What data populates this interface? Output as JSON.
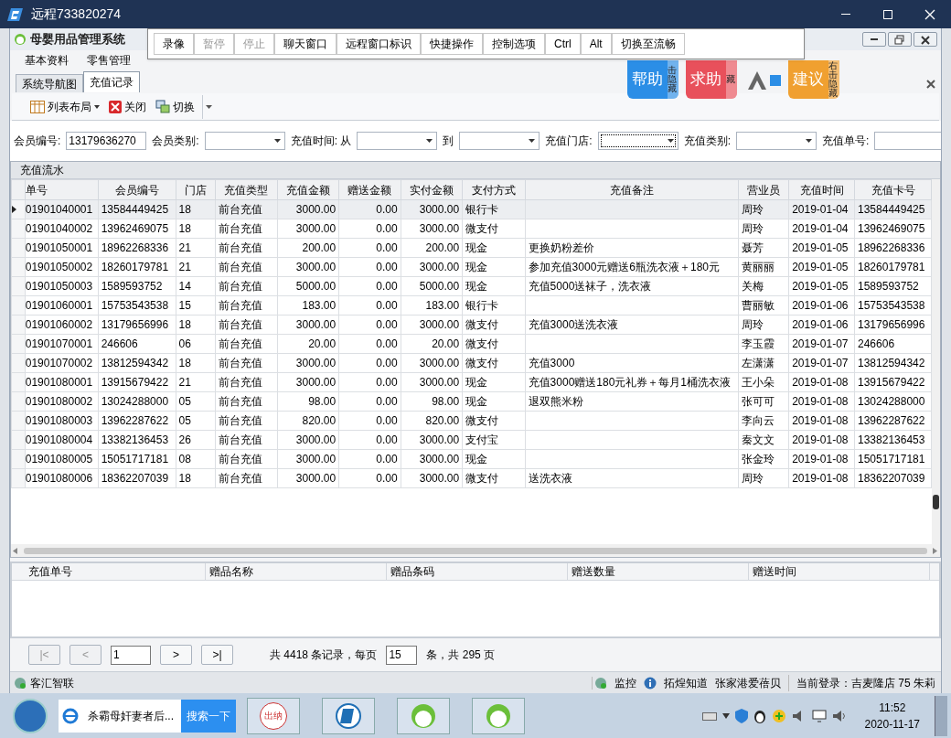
{
  "window": {
    "title": "远程733820274"
  },
  "remote_toolbar": [
    {
      "label": "录像",
      "disabled": false
    },
    {
      "label": "暂停",
      "disabled": true
    },
    {
      "label": "停止",
      "disabled": true
    },
    {
      "label": "聊天窗口",
      "disabled": false
    },
    {
      "label": "远程窗口标识",
      "disabled": false
    },
    {
      "label": "快捷操作",
      "disabled": false
    },
    {
      "label": "控制选项",
      "disabled": false
    },
    {
      "label": "Ctrl",
      "disabled": false
    },
    {
      "label": "Alt",
      "disabled": false
    },
    {
      "label": "切换至流畅",
      "disabled": false
    }
  ],
  "app": {
    "title": "母婴用品管理系统"
  },
  "menu": [
    "基本资料",
    "零售管理"
  ],
  "promo_badges": [
    {
      "main": "帮助",
      "side": "击隐藏",
      "color": "#2b8ee6"
    },
    {
      "main": "求助",
      "side": "藏",
      "color": "#e8505b"
    },
    {
      "main": "建议",
      "side": "右击隐藏",
      "color": "#f0a030"
    }
  ],
  "tabs": [
    {
      "label": "系统导航图",
      "selected": false
    },
    {
      "label": "充值记录",
      "selected": true
    }
  ],
  "toolbar": [
    {
      "label": "列表布局",
      "kind": "dropdown"
    },
    {
      "label": "关闭",
      "kind": "close"
    },
    {
      "label": "切换",
      "kind": "switch"
    }
  ],
  "filters": [
    {
      "label": "会员编号:",
      "value": "13179636270",
      "kind": "text"
    },
    {
      "label": "会员类别:",
      "kind": "combo"
    },
    {
      "label": "充值时间: 从",
      "kind": "combo"
    },
    {
      "label": "到",
      "kind": "combo"
    },
    {
      "label": "充值门店:",
      "kind": "combo",
      "focused": true
    },
    {
      "label": "充值类别:",
      "kind": "combo"
    },
    {
      "label": "充值单号:",
      "kind": "text"
    }
  ],
  "grid": {
    "group_title": "充值流水",
    "columns": [
      "单号",
      "会员编号",
      "门店",
      "充值类型",
      "充值金额",
      "赠送金额",
      "实付金额",
      "支付方式",
      "充值备注",
      "营业员",
      "充值时间",
      "充值卡号"
    ],
    "rows": [
      {
        "selected": true,
        "cells": [
          "01901040001",
          "13584449425",
          "18",
          "前台充值",
          "3000.00",
          "0.00",
          "3000.00",
          "银行卡",
          "",
          "周玲",
          "2019-01-04",
          "13584449425"
        ]
      },
      {
        "selected": false,
        "cells": [
          "01901040002",
          "13962469075",
          "18",
          "前台充值",
          "3000.00",
          "0.00",
          "3000.00",
          "微支付",
          "",
          "周玲",
          "2019-01-04",
          "13962469075"
        ]
      },
      {
        "selected": false,
        "cells": [
          "01901050001",
          "18962268336",
          "21",
          "前台充值",
          "200.00",
          "0.00",
          "200.00",
          "现金",
          "更换奶粉差价",
          "聂芳",
          "2019-01-05",
          "18962268336"
        ]
      },
      {
        "selected": false,
        "cells": [
          "01901050002",
          "18260179781",
          "21",
          "前台充值",
          "3000.00",
          "0.00",
          "3000.00",
          "现金",
          "参加充值3000元赠送6瓶洗衣液＋180元",
          "黄丽丽",
          "2019-01-05",
          "18260179781"
        ]
      },
      {
        "selected": false,
        "cells": [
          "01901050003",
          "1589593752",
          "14",
          "前台充值",
          "5000.00",
          "0.00",
          "5000.00",
          "现金",
          "充值5000送袜子，洗衣液",
          "关梅",
          "2019-01-05",
          "1589593752"
        ]
      },
      {
        "selected": false,
        "cells": [
          "01901060001",
          "15753543538",
          "15",
          "前台充值",
          "183.00",
          "0.00",
          "183.00",
          "银行卡",
          "",
          "曹丽敏",
          "2019-01-06",
          "15753543538"
        ]
      },
      {
        "selected": false,
        "cells": [
          "01901060002",
          "13179656996",
          "18",
          "前台充值",
          "3000.00",
          "0.00",
          "3000.00",
          "微支付",
          "充值3000送洗衣液",
          "周玲",
          "2019-01-06",
          "13179656996"
        ]
      },
      {
        "selected": false,
        "cells": [
          "01901070001",
          "246606",
          "06",
          "前台充值",
          "20.00",
          "0.00",
          "20.00",
          "微支付",
          "",
          "李玉霞",
          "2019-01-07",
          "246606"
        ]
      },
      {
        "selected": false,
        "cells": [
          "01901070002",
          "13812594342",
          "18",
          "前台充值",
          "3000.00",
          "0.00",
          "3000.00",
          "微支付",
          "充值3000",
          "左潇潇",
          "2019-01-07",
          "13812594342"
        ]
      },
      {
        "selected": false,
        "cells": [
          "01901080001",
          "13915679422",
          "21",
          "前台充值",
          "3000.00",
          "0.00",
          "3000.00",
          "现金",
          "充值3000赠送180元礼券＋每月1桶洗衣液",
          "王小朵",
          "2019-01-08",
          "13915679422"
        ]
      },
      {
        "selected": false,
        "cells": [
          "01901080002",
          "13024288000",
          "05",
          "前台充值",
          "98.00",
          "0.00",
          "98.00",
          "现金",
          "退双熊米粉",
          "张可可",
          "2019-01-08",
          "13024288000"
        ]
      },
      {
        "selected": false,
        "cells": [
          "01901080003",
          "13962287622",
          "05",
          "前台充值",
          "820.00",
          "0.00",
          "820.00",
          "微支付",
          "",
          "李向云",
          "2019-01-08",
          "13962287622"
        ]
      },
      {
        "selected": false,
        "cells": [
          "01901080004",
          "13382136453",
          "26",
          "前台充值",
          "3000.00",
          "0.00",
          "3000.00",
          "支付宝",
          "",
          "秦文文",
          "2019-01-08",
          "13382136453"
        ]
      },
      {
        "selected": false,
        "cells": [
          "01901080005",
          "15051717181",
          "08",
          "前台充值",
          "3000.00",
          "0.00",
          "3000.00",
          "现金",
          "",
          "张金玲",
          "2019-01-08",
          "15051717181"
        ]
      },
      {
        "selected": false,
        "cells": [
          "01901080006",
          "18362207039",
          "18",
          "前台充值",
          "3000.00",
          "0.00",
          "3000.00",
          "微支付",
          "送洗衣液",
          "周玲",
          "2019-01-08",
          "18362207039"
        ]
      }
    ]
  },
  "gift_grid": {
    "columns": [
      "充值单号",
      "赠品名称",
      "赠品条码",
      "赠送数量",
      "赠送时间"
    ]
  },
  "pager": {
    "buttons": [
      {
        "label": "|<",
        "disabled": true
      },
      {
        "label": "<",
        "disabled": true
      },
      {
        "label": ">",
        "disabled": false
      },
      {
        "label": ">|",
        "disabled": false
      }
    ],
    "page": "1",
    "summary_before": "共 4418 条记录，每页",
    "page_size": "15",
    "summary_after": "条，共 295 页"
  },
  "status_bar": {
    "left": "客汇智联",
    "items": [
      "监控",
      "拓煌知道",
      "张家港爱蓓贝"
    ],
    "login": "当前登录：吉麦隆店 75 朱莉"
  },
  "taskbar": {
    "search_text": "杀霸母奸妻者后...",
    "search_button": "搜索一下",
    "app_badge": "出纳",
    "time": "11:52",
    "date": "2020-11-17"
  }
}
